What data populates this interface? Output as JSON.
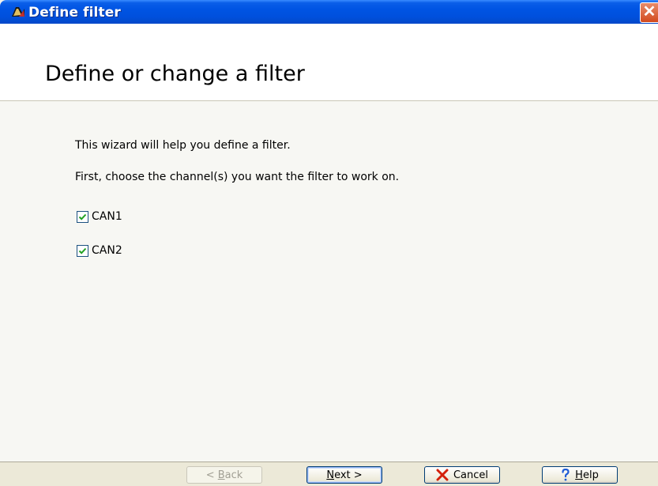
{
  "window": {
    "title": "Define filter",
    "close_glyph": "✕"
  },
  "header": {
    "title": "Define or change a filter"
  },
  "content": {
    "intro": "This wizard will help you define a filter.",
    "instruction": "First, choose the channel(s) you want the filter to work on.",
    "channels": [
      {
        "label": "CAN1",
        "checked": true
      },
      {
        "label": "CAN2",
        "checked": true
      }
    ]
  },
  "buttons": {
    "back": {
      "prefix": "< ",
      "mnemonic": "B",
      "rest": "ack",
      "enabled": false
    },
    "next": {
      "mnemonic": "N",
      "rest": "ext >",
      "enabled": true
    },
    "cancel": {
      "label": "Cancel",
      "icon": "x-icon",
      "icon_color": "#d4200b"
    },
    "help": {
      "mnemonic": "H",
      "rest": "elp",
      "icon": "question-icon",
      "icon_color": "#1e5bd6"
    }
  },
  "colors": {
    "titlebar": "#0054e3",
    "check": "#21a121"
  }
}
